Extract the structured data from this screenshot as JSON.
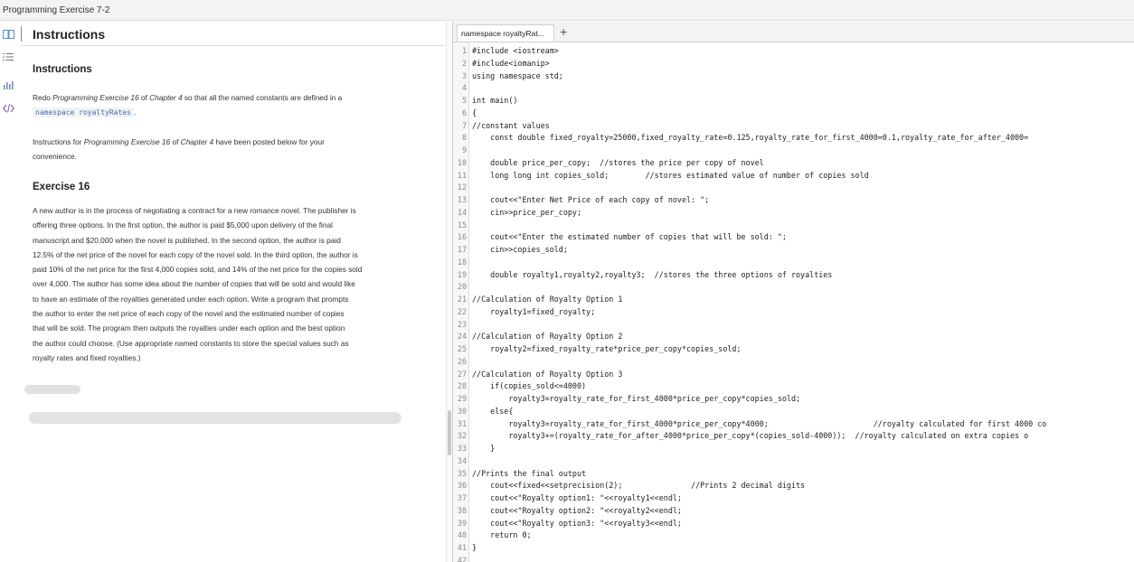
{
  "window": {
    "title": "Programming Exercise 7-2"
  },
  "instructions": {
    "header": "Instructions",
    "heading": "Instructions",
    "intro_pre": "Redo ",
    "intro_em1": "Programming Exercise 16",
    "intro_mid": " of ",
    "intro_em2": "Chapter 4",
    "intro_post": " so that all the named constants are defined in a",
    "namespace_code": "namespace royaltyRates",
    "after_code": ".",
    "note_pre": "Instructions for ",
    "note_em1": "Programming Exercise 16",
    "note_mid": " of ",
    "note_em2": "Chapter 4",
    "note_post": " have been posted below for your",
    "note_line2": "convenience.",
    "exercise_heading": "Exercise 16",
    "exercise_lines": [
      "A new author is in the process of negotiating a contract for a new romance novel. The publisher is",
      "offering three options. In the first option, the author is paid $5,000 upon delivery of the final",
      "manuscript and $20,000 when the novel is published. In the second option, the author is paid",
      "12.5% of the net price of the novel for each copy of the novel sold. In the third option, the author is",
      "paid 10% of the net price for the first 4,000 copies sold, and 14% of the net price for the copies sold",
      "over 4,000. The author has some idea about the number of copies that will be sold and would like",
      "to have an estimate of the royalties generated under each option. Write a program that prompts",
      "the author to enter the net price of each copy of the novel and the estimated number of copies",
      "that will be sold. The program then outputs the royalties under each option and the best option",
      "the author could choose. (Use appropriate named constants to store the special values such as",
      "royalty rates and fixed royalties.)"
    ]
  },
  "sidebar": {
    "icons": [
      "book-icon",
      "list-icon",
      "chart-icon",
      "code-icon"
    ]
  },
  "editor": {
    "tab_label": "namespace royaltyRat...",
    "add_tab_label": "+",
    "code_lines": [
      "#include <iostream>",
      "#include<iomanip>",
      "using namespace std;",
      "",
      "int main()",
      "{",
      "//constant values",
      "    const double fixed_royalty=25000,fixed_royalty_rate=0.125,royalty_rate_for_first_4000=0.1,royalty_rate_for_after_4000=",
      "",
      "    double price_per_copy;  //stores the price per copy of novel",
      "    long long int copies_sold;        //stores estimated value of number of copies sold",
      "",
      "    cout<<\"Enter Net Price of each copy of novel: \";",
      "    cin>>price_per_copy;",
      "",
      "    cout<<\"Enter the estimated number of copies that will be sold: \";",
      "    cin>>copies_sold;",
      "",
      "    double royalty1,royalty2,royalty3;  //stores the three options of royalties",
      "",
      "//Calculation of Royalty Option 1",
      "    royalty1=fixed_royalty;",
      "",
      "//Calculation of Royalty Option 2",
      "    royalty2=fixed_royalty_rate*price_per_copy*copies_sold;",
      "",
      "//Calculation of Royalty Option 3",
      "    if(copies_sold<=4000)",
      "        royalty3=royalty_rate_for_first_4000*price_per_copy*copies_sold;",
      "    else{",
      "        royalty3=royalty_rate_for_first_4000*price_per_copy*4000;                       //royalty calculated for first 4000 co",
      "        royalty3+=(royalty_rate_for_after_4000*price_per_copy*(copies_sold-4000));  //royalty calculated on extra copies o",
      "    }",
      "",
      "//Prints the final output",
      "    cout<<fixed<<setprecision(2);               //Prints 2 decimal digits",
      "    cout<<\"Royalty option1: \"<<royalty1<<endl;",
      "    cout<<\"Royalty option2: \"<<royalty2<<endl;",
      "    cout<<\"Royalty option3: \"<<royalty3<<endl;",
      "    return 0;",
      "}",
      ""
    ]
  }
}
